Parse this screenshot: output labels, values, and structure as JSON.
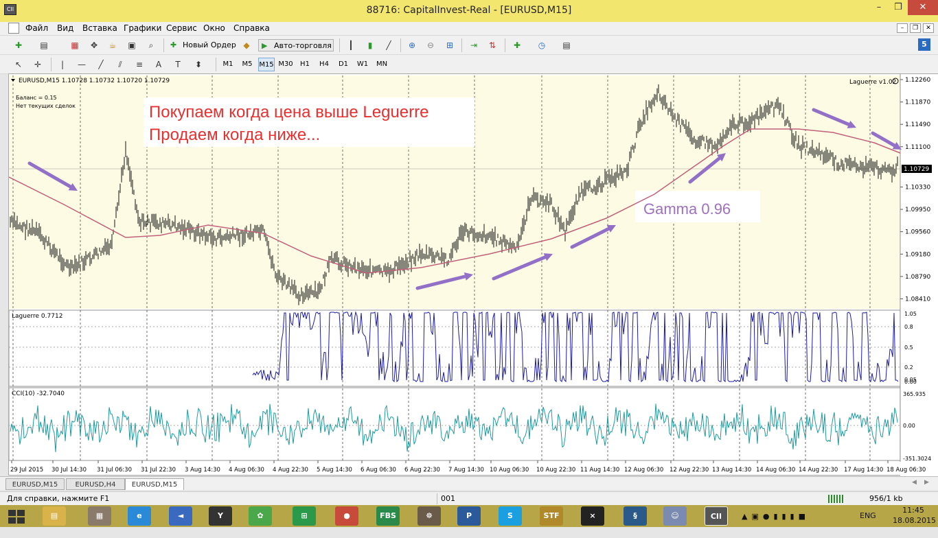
{
  "window": {
    "title": "88716: CapitalInvest-Real - [EURUSD,M15]"
  },
  "menu": [
    "Файл",
    "Вид",
    "Вставка",
    "Графики",
    "Сервис",
    "Окно",
    "Справка"
  ],
  "toolbar": {
    "new_order": "Новый Ордер",
    "auto_trading": "Авто-торговля",
    "notif_badge": "5"
  },
  "timeframes": {
    "items": [
      "M1",
      "M5",
      "M15",
      "M30",
      "H1",
      "H4",
      "D1",
      "W1",
      "MN"
    ],
    "active": "M15"
  },
  "chart": {
    "header": "EURUSD,M15  1.10728 1.10732 1.10720 1.10729",
    "balance": "Баланс = 0.15",
    "no_deals": "Нет текущих сделок",
    "indicator_name": "Laguerre v1.02",
    "annotation_line1": "Покупаем когда цена выше Leguerre",
    "annotation_line2": "Продаем когда ниже...",
    "gamma_label": "Gamma 0.96",
    "price_ticks": [
      "1.12260",
      "1.11870",
      "1.11490",
      "1.11100",
      "1.10729",
      "1.10330",
      "1.09950",
      "1.09560",
      "1.09180",
      "1.08790",
      "1.08410"
    ],
    "current_price": "1.10729",
    "laguerre_label": "Laguerre 0.7712",
    "laguerre_ticks": [
      "1.05",
      "0.8",
      "0.5",
      "0.2",
      "0.05",
      "0.00"
    ],
    "cci_label": "CCI(10) -32.7040",
    "cci_ticks": [
      "365.935",
      "0.00",
      "-351.3024"
    ],
    "time_labels": [
      "29 Jul 2015",
      "30 Jul 14:30",
      "31 Jul 06:30",
      "31 Jul 22:30",
      "3 Aug 14:30",
      "4 Aug 06:30",
      "4 Aug 22:30",
      "5 Aug 14:30",
      "6 Aug 06:30",
      "6 Aug 22:30",
      "7 Aug 14:30",
      "10 Aug 06:30",
      "10 Aug 22:30",
      "11 Aug 14:30",
      "12 Aug 06:30",
      "12 Aug 22:30",
      "13 Aug 14:30",
      "14 Aug 06:30",
      "14 Aug 22:30",
      "17 Aug 14:30",
      "18 Aug 06:30"
    ],
    "colors": {
      "price_bg": "#fdfbe3",
      "ind_bg": "#ffffff",
      "laguerre_line": "#c0607a",
      "laguerre_osc": "#1a1aa8",
      "cci_line": "#1c9aa0",
      "annot_text": "#e53030",
      "gamma_text": "#a070c0",
      "arrow": "#9370c8"
    }
  },
  "tabs": {
    "items": [
      "EURUSD,M15",
      "EURUSD,H4",
      "EURUSD,M15"
    ],
    "active_index": 2
  },
  "status": {
    "help": "Для справки, нажмите F1",
    "profile": "001",
    "traffic": "956/1 kb"
  },
  "taskbar": {
    "apps": [
      "FBS",
      "P",
      "S",
      "STF"
    ],
    "lang": "ENG",
    "time": "11:45",
    "date": "18.08.2015"
  }
}
